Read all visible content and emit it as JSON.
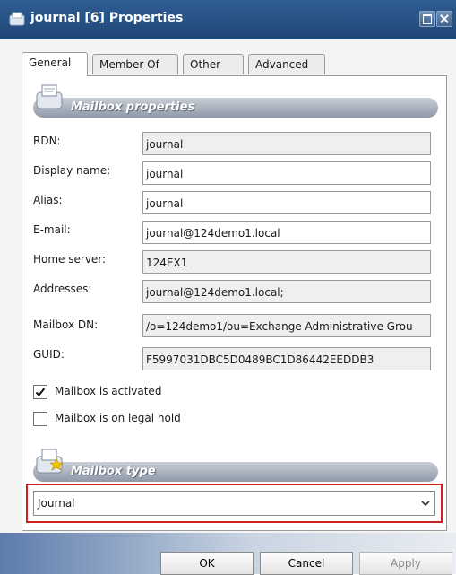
{
  "window": {
    "title": "journal [6] Properties"
  },
  "tabs": [
    {
      "label": "General",
      "active": true
    },
    {
      "label": "Member Of"
    },
    {
      "label": "Other"
    },
    {
      "label": "Advanced"
    }
  ],
  "sections": {
    "mailbox_properties": "Mailbox properties",
    "mailbox_type": "Mailbox type"
  },
  "fields": {
    "rdn": {
      "label": "RDN:",
      "value": "journal",
      "readonly": true
    },
    "display_name": {
      "label": "Display name:",
      "value": "journal",
      "readonly": false
    },
    "alias": {
      "label": "Alias:",
      "value": "journal",
      "readonly": false
    },
    "email": {
      "label": "E-mail:",
      "value": "journal@124demo1.local",
      "readonly": false
    },
    "home_server": {
      "label": "Home server:",
      "value": "124EX1",
      "readonly": true
    },
    "addresses": {
      "label": "Addresses:",
      "value": "journal@124demo1.local;",
      "readonly": true
    },
    "mailbox_dn": {
      "label": "Mailbox DN:",
      "value": "/o=124demo1/ou=Exchange Administrative Grou",
      "readonly": true
    },
    "guid": {
      "label": "GUID:",
      "value": "F5997031DBC5D0489BC1D86442EEDDB3",
      "readonly": true
    }
  },
  "checkboxes": {
    "activated": {
      "label": "Mailbox is activated",
      "checked": true
    },
    "legal_hold": {
      "label": "Mailbox is on legal hold",
      "checked": false
    }
  },
  "mailbox_type_select": {
    "value": "Journal"
  },
  "buttons": {
    "ok": "OK",
    "cancel": "Cancel",
    "apply": "Apply"
  },
  "colors": {
    "title_bar": "#1f4777",
    "highlight_border": "#d02020"
  }
}
